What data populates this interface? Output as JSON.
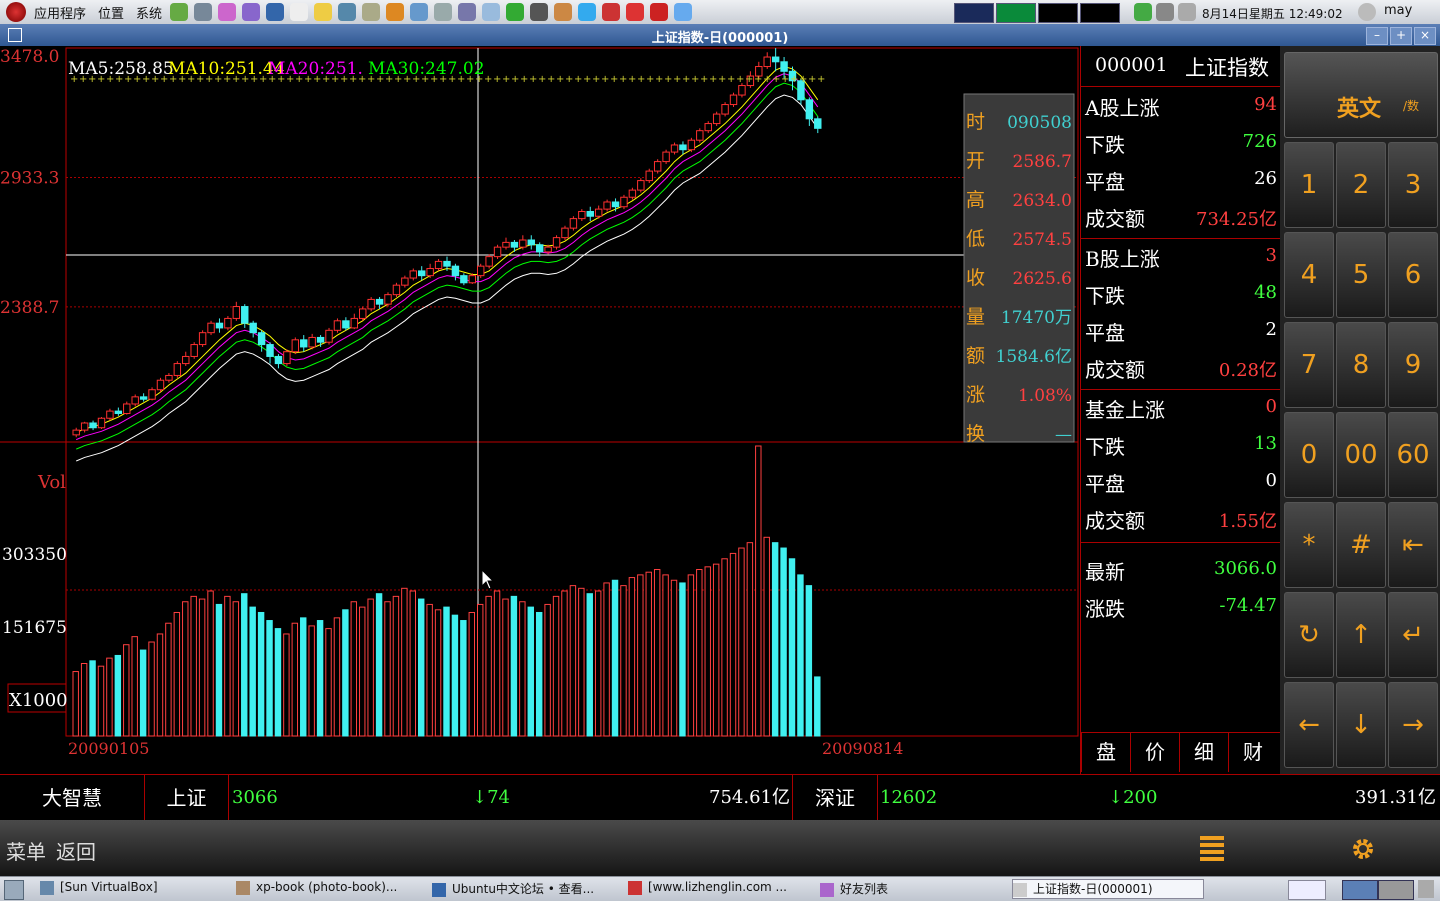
{
  "top_panel": {
    "menus": [
      "应用程序",
      "位置",
      "系统"
    ],
    "datetime": "8月14日星期五 12:49:02",
    "user": "may"
  },
  "window": {
    "title": "上证指数-日(000001)",
    "min_label": "–",
    "max_label": "+",
    "close_label": "×"
  },
  "chart_data": [
    {
      "type": "candlestick",
      "price_ticks": [
        "3478.0",
        "2933.3",
        "2388.7"
      ],
      "ma_labels": [
        "MA5:258.85",
        "MA10:251.44",
        "MA20:251.",
        "MA30:247.02"
      ],
      "ma_colors": [
        "#ffffff",
        "#ffff00",
        "#ff00ff",
        "#00ff00"
      ],
      "x_start_label": "20090105",
      "x_end_label": "20090814",
      "ylim": [
        2000,
        3478
      ],
      "candles": [
        [
          1850,
          1870,
          1840,
          1880
        ],
        [
          1870,
          1900,
          1860,
          1905
        ],
        [
          1900,
          1880,
          1870,
          1910
        ],
        [
          1880,
          1920,
          1875,
          1925
        ],
        [
          1920,
          1950,
          1910,
          1960
        ],
        [
          1950,
          1940,
          1930,
          1965
        ],
        [
          1940,
          1980,
          1935,
          1990
        ],
        [
          1980,
          2010,
          1970,
          2020
        ],
        [
          2010,
          2000,
          1990,
          2025
        ],
        [
          2000,
          2040,
          1995,
          2050
        ],
        [
          2040,
          2080,
          2030,
          2090
        ],
        [
          2080,
          2100,
          2070,
          2110
        ],
        [
          2100,
          2150,
          2090,
          2160
        ],
        [
          2150,
          2180,
          2140,
          2200
        ],
        [
          2180,
          2230,
          2170,
          2240
        ],
        [
          2230,
          2280,
          2220,
          2290
        ],
        [
          2280,
          2320,
          2270,
          2330
        ],
        [
          2320,
          2300,
          2280,
          2340
        ],
        [
          2300,
          2340,
          2290,
          2350
        ],
        [
          2340,
          2390,
          2330,
          2410
        ],
        [
          2390,
          2320,
          2300,
          2400
        ],
        [
          2320,
          2280,
          2260,
          2330
        ],
        [
          2280,
          2230,
          2200,
          2290
        ],
        [
          2230,
          2180,
          2150,
          2240
        ],
        [
          2180,
          2150,
          2130,
          2190
        ],
        [
          2150,
          2200,
          2140,
          2210
        ],
        [
          2200,
          2250,
          2190,
          2260
        ],
        [
          2250,
          2220,
          2200,
          2270
        ],
        [
          2220,
          2260,
          2210,
          2275
        ],
        [
          2260,
          2240,
          2220,
          2270
        ],
        [
          2240,
          2290,
          2230,
          2300
        ],
        [
          2290,
          2330,
          2280,
          2340
        ],
        [
          2330,
          2300,
          2290,
          2345
        ],
        [
          2300,
          2340,
          2295,
          2360
        ],
        [
          2340,
          2380,
          2330,
          2390
        ],
        [
          2380,
          2420,
          2370,
          2430
        ],
        [
          2420,
          2400,
          2380,
          2430
        ],
        [
          2400,
          2440,
          2390,
          2450
        ],
        [
          2440,
          2480,
          2430,
          2490
        ],
        [
          2480,
          2510,
          2470,
          2520
        ],
        [
          2510,
          2540,
          2500,
          2550
        ],
        [
          2540,
          2520,
          2500,
          2560
        ],
        [
          2520,
          2550,
          2510,
          2570
        ],
        [
          2550,
          2580,
          2540,
          2590
        ],
        [
          2580,
          2560,
          2540,
          2600
        ],
        [
          2560,
          2520,
          2500,
          2570
        ],
        [
          2520,
          2490,
          2480,
          2530
        ],
        [
          2490,
          2520,
          2485,
          2530
        ],
        [
          2520,
          2560,
          2510,
          2570
        ],
        [
          2560,
          2600,
          2550,
          2610
        ],
        [
          2600,
          2640,
          2590,
          2650
        ],
        [
          2640,
          2660,
          2630,
          2680
        ],
        [
          2660,
          2640,
          2620,
          2670
        ],
        [
          2640,
          2670,
          2630,
          2690
        ],
        [
          2670,
          2650,
          2630,
          2690
        ],
        [
          2650,
          2620,
          2600,
          2660
        ],
        [
          2620,
          2640,
          2610,
          2650
        ],
        [
          2640,
          2680,
          2630,
          2690
        ],
        [
          2680,
          2720,
          2670,
          2730
        ],
        [
          2720,
          2760,
          2710,
          2770
        ],
        [
          2760,
          2790,
          2750,
          2800
        ],
        [
          2790,
          2770,
          2750,
          2810
        ],
        [
          2770,
          2800,
          2760,
          2815
        ],
        [
          2800,
          2830,
          2790,
          2840
        ],
        [
          2830,
          2810,
          2790,
          2845
        ],
        [
          2810,
          2850,
          2800,
          2860
        ],
        [
          2850,
          2880,
          2840,
          2890
        ],
        [
          2880,
          2920,
          2870,
          2930
        ],
        [
          2920,
          2960,
          2910,
          2970
        ],
        [
          2960,
          3000,
          2950,
          3010
        ],
        [
          3000,
          3040,
          2990,
          3050
        ],
        [
          3040,
          3070,
          3030,
          3080
        ],
        [
          3070,
          3050,
          3030,
          3085
        ],
        [
          3050,
          3090,
          3040,
          3100
        ],
        [
          3090,
          3130,
          3080,
          3140
        ],
        [
          3130,
          3160,
          3120,
          3170
        ],
        [
          3160,
          3200,
          3150,
          3210
        ],
        [
          3200,
          3240,
          3190,
          3250
        ],
        [
          3240,
          3280,
          3230,
          3290
        ],
        [
          3280,
          3320,
          3270,
          3330
        ],
        [
          3320,
          3360,
          3310,
          3380
        ],
        [
          3360,
          3400,
          3350,
          3420
        ],
        [
          3400,
          3440,
          3390,
          3460
        ],
        [
          3440,
          3420,
          3380,
          3478
        ],
        [
          3420,
          3380,
          3350,
          3440
        ],
        [
          3380,
          3340,
          3300,
          3400
        ],
        [
          3340,
          3260,
          3240,
          3350
        ],
        [
          3260,
          3180,
          3150,
          3270
        ],
        [
          3180,
          3140,
          3120,
          3190
        ]
      ],
      "ma5": [
        1860,
        1875,
        1885,
        1895,
        1910,
        1925,
        1945,
        1965,
        1985,
        2005,
        2030,
        2060,
        2085,
        2110,
        2145,
        2180,
        2215,
        2250,
        2280,
        2310,
        2320,
        2310,
        2290,
        2265,
        2230,
        2205,
        2195,
        2200,
        2215,
        2230,
        2245,
        2270,
        2290,
        2310,
        2330,
        2360,
        2380,
        2400,
        2425,
        2450,
        2480,
        2500,
        2520,
        2540,
        2550,
        2545,
        2535,
        2525,
        2525,
        2540,
        2570,
        2600,
        2625,
        2640,
        2650,
        2650,
        2645,
        2650,
        2665,
        2690,
        2720,
        2745,
        2765,
        2785,
        2800,
        2815,
        2835,
        2860,
        2890,
        2925,
        2960,
        3000,
        3030,
        3050,
        3070,
        3100,
        3130,
        3160,
        3195,
        3230,
        3270,
        3310,
        3350,
        3385,
        3400,
        3390,
        3360,
        3310,
        3260
      ],
      "volumes": [
        120,
        135,
        140,
        130,
        145,
        150,
        170,
        185,
        160,
        175,
        190,
        210,
        230,
        250,
        260,
        255,
        270,
        245,
        260,
        250,
        265,
        240,
        230,
        215,
        200,
        190,
        210,
        220,
        205,
        215,
        200,
        220,
        235,
        250,
        240,
        255,
        265,
        250,
        260,
        275,
        270,
        255,
        245,
        235,
        240,
        225,
        215,
        230,
        245,
        260,
        270,
        255,
        260,
        250,
        240,
        230,
        245,
        260,
        270,
        280,
        275,
        265,
        270,
        285,
        290,
        280,
        295,
        300,
        305,
        310,
        300,
        290,
        285,
        300,
        310,
        315,
        320,
        330,
        340,
        350,
        360,
        540,
        370,
        360,
        350,
        330,
        300,
        280,
        110
      ],
      "vol_ticks": [
        "303350",
        "151675"
      ],
      "vol_label": "Vol",
      "vol_unit": "X1000",
      "tooltip": {
        "labels": [
          "时",
          "开",
          "高",
          "低",
          "收",
          "量",
          "额",
          "涨",
          "换"
        ],
        "values": [
          "090508",
          "2586.7",
          "2634.0",
          "2574.5",
          "2625.6",
          "17470万",
          "1584.6亿",
          "1.08%",
          "—"
        ]
      }
    }
  ],
  "right_panel": {
    "code": "000001",
    "name": "上证指数",
    "rows": [
      {
        "label": "A股上涨",
        "value": "94",
        "color": "#ff4040"
      },
      {
        "label": "下跌",
        "value": "726",
        "color": "#40ff40"
      },
      {
        "label": "平盘",
        "value": "26",
        "color": "#ffffff"
      },
      {
        "label": "成交额",
        "value": "734.25亿",
        "color": "#ff4040"
      },
      {
        "label": "B股上涨",
        "value": "3",
        "color": "#ff4040"
      },
      {
        "label": "下跌",
        "value": "48",
        "color": "#40ff40"
      },
      {
        "label": "平盘",
        "value": "2",
        "color": "#ffffff"
      },
      {
        "label": "成交额",
        "value": "0.28亿",
        "color": "#ff4040"
      },
      {
        "label": "基金上涨",
        "value": "0",
        "color": "#ff4040"
      },
      {
        "label": "下跌",
        "value": "13",
        "color": "#40ff40"
      },
      {
        "label": "平盘",
        "value": "0",
        "color": "#ffffff"
      },
      {
        "label": "成交额",
        "value": "1.55亿",
        "color": "#ff4040"
      },
      {
        "label": "最新",
        "value": "3066.0",
        "color": "#40ff40"
      },
      {
        "label": "涨跌",
        "value": "-74.47",
        "color": "#40ff40"
      }
    ],
    "tabs": [
      "盘",
      "价",
      "细",
      "财"
    ]
  },
  "keypad": {
    "mode_label": "英文",
    "mode_alt": "/数",
    "keys": [
      "1",
      "2",
      "3",
      "4",
      "5",
      "6",
      "7",
      "8",
      "9",
      "0",
      "00",
      "60",
      "*",
      "#",
      "⇤",
      "↻",
      "↑",
      "↵",
      "←",
      "↓",
      "→"
    ]
  },
  "quote_bar": {
    "brand": "大智慧",
    "sh_label": "上证",
    "sh_value": "3066",
    "sh_change": "↓74",
    "sh_amount": "754.61亿",
    "sz_label": "深证",
    "sz_value": "12602",
    "sz_change": "↓200",
    "sz_amount": "391.31亿"
  },
  "menu_bar": {
    "menu_label": "菜单",
    "back_label": "返回"
  },
  "taskbar": {
    "tasks": [
      "[Sun VirtualBox]",
      "xp-book (photo-book)...",
      "Ubuntu中文论坛 • 查看...",
      "[www.lizhenglin.com ...",
      "好友列表",
      "上证指数-日(000001)"
    ]
  }
}
